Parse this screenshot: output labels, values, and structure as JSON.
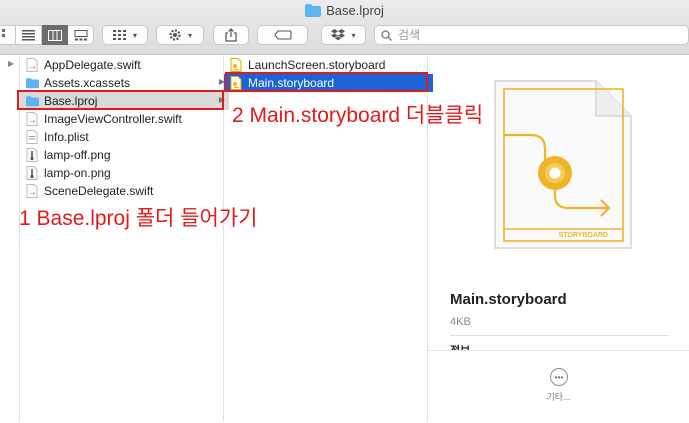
{
  "window": {
    "title": "Base.lproj"
  },
  "toolbar": {
    "search_placeholder": "검색"
  },
  "columns": {
    "col1": [
      {
        "label": "AppDelegate.swift",
        "icon": "swift-file-icon"
      },
      {
        "label": "Assets.xcassets",
        "icon": "folder-icon",
        "arrow": true
      },
      {
        "label": "Base.lproj",
        "icon": "folder-icon",
        "arrow": true,
        "selected": true
      },
      {
        "label": "ImageViewController.swift",
        "icon": "swift-file-icon"
      },
      {
        "label": "Info.plist",
        "icon": "plist-file-icon"
      },
      {
        "label": "lamp-off.png",
        "icon": "image-file-icon"
      },
      {
        "label": "lamp-on.png",
        "icon": "image-file-icon"
      },
      {
        "label": "SceneDelegate.swift",
        "icon": "swift-file-icon"
      }
    ],
    "col2": [
      {
        "label": "LaunchScreen.storyboard",
        "icon": "storyboard-file-icon"
      },
      {
        "label": "Main.storyboard",
        "icon": "storyboard-file-icon",
        "selected": true
      }
    ]
  },
  "annotations": {
    "step1": "1 Base.lproj 폴더 들어가기",
    "step2": "2 Main.storyboard 더블클릭"
  },
  "preview": {
    "doc_label": "STORYBOARD",
    "name": "Main.storyboard",
    "size": "4KB",
    "info_label": "정보",
    "more_label": "기타..."
  },
  "colors": {
    "selection_blue": "#1e63d6",
    "annotation_red": "#e01b1b",
    "folder_blue": "#5fb3f0",
    "storyboard_yellow": "#f0b429"
  }
}
